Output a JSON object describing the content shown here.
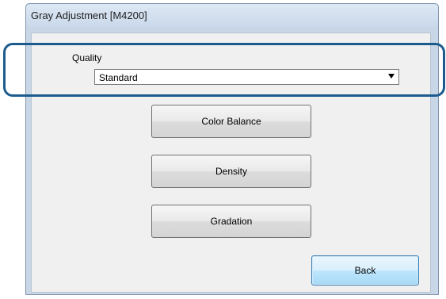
{
  "window": {
    "title": "Gray Adjustment [M4200]"
  },
  "quality": {
    "label": "Quality",
    "selected": "Standard"
  },
  "buttons": {
    "color_balance": "Color Balance",
    "density": "Density",
    "gradation": "Gradation",
    "back": "Back"
  },
  "icons": {
    "dropdown": "chevron-down-icon"
  },
  "colors": {
    "highlight": "#1c5b8e",
    "default_button_border": "#3c7fb1"
  }
}
